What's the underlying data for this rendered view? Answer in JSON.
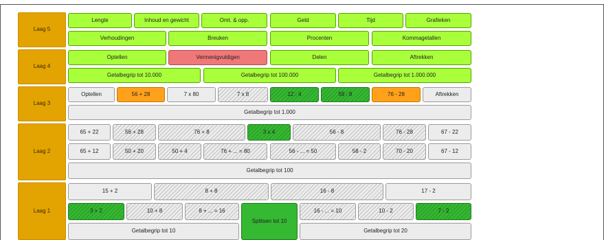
{
  "layers": {
    "laag5": "Laag 5",
    "laag4": "Laag 4",
    "laag3": "Laag 3",
    "laag2": "Laag 2",
    "laag1": "Laag 1"
  },
  "colors": {
    "layer": "#e3a300",
    "lime": "#a8ff3a",
    "pink": "#f07878",
    "orange": "#ffa11a",
    "gray": "#ececec",
    "green": "#35b832"
  },
  "l5": {
    "row1": [
      "Lengte",
      "Inhoud en gewicht",
      "Omt. & opp.",
      "Geld",
      "Tijd",
      "Grafieken"
    ],
    "row2": [
      "Verhoudingen",
      "Breuken",
      "Procenten",
      "Kommagetallen"
    ]
  },
  "l4": {
    "row1": [
      "Optellen",
      "Vermenigvuldigen",
      "Delen",
      "Aftrekken"
    ],
    "row2": [
      "Getalbegrip tot 10.000",
      "Getalbegrip tot 100.000",
      "Getalbegrip tot 1.000.000"
    ]
  },
  "l3": {
    "row1": [
      "Optellen",
      "56 + 28",
      "7 x 80",
      "7 x 8",
      "12 : 4",
      "59 : 8",
      "76 - 28",
      "Aftrekken"
    ],
    "row2": "Getalbegrip tot 1.000"
  },
  "l2": {
    "row1": [
      "65 + 22",
      "56 + 28",
      "76 + 8",
      "3 x 4",
      "56 - 8",
      "76 - 28",
      "67 - 22"
    ],
    "row2": [
      "65 + 12",
      "50 + 20",
      "50 + 4",
      "76 + ... = 80",
      "56 - ... = 50",
      "58 - 2",
      "70 - 20",
      "67 - 12"
    ],
    "row3": "Getalbegrip tot 100"
  },
  "l1": {
    "row1": [
      "15 + 2",
      "8 + 8",
      "16 - 8",
      "17 - 2"
    ],
    "row2": [
      "3 + 2",
      "10 + 8",
      "8 + ... = 16",
      "Splitsen tot 10",
      "16 - ... = 10",
      "10 - 2",
      "7 - 2"
    ],
    "row3": [
      "Getalbegrip tot 10",
      "Getalbegrip tot 20"
    ]
  }
}
